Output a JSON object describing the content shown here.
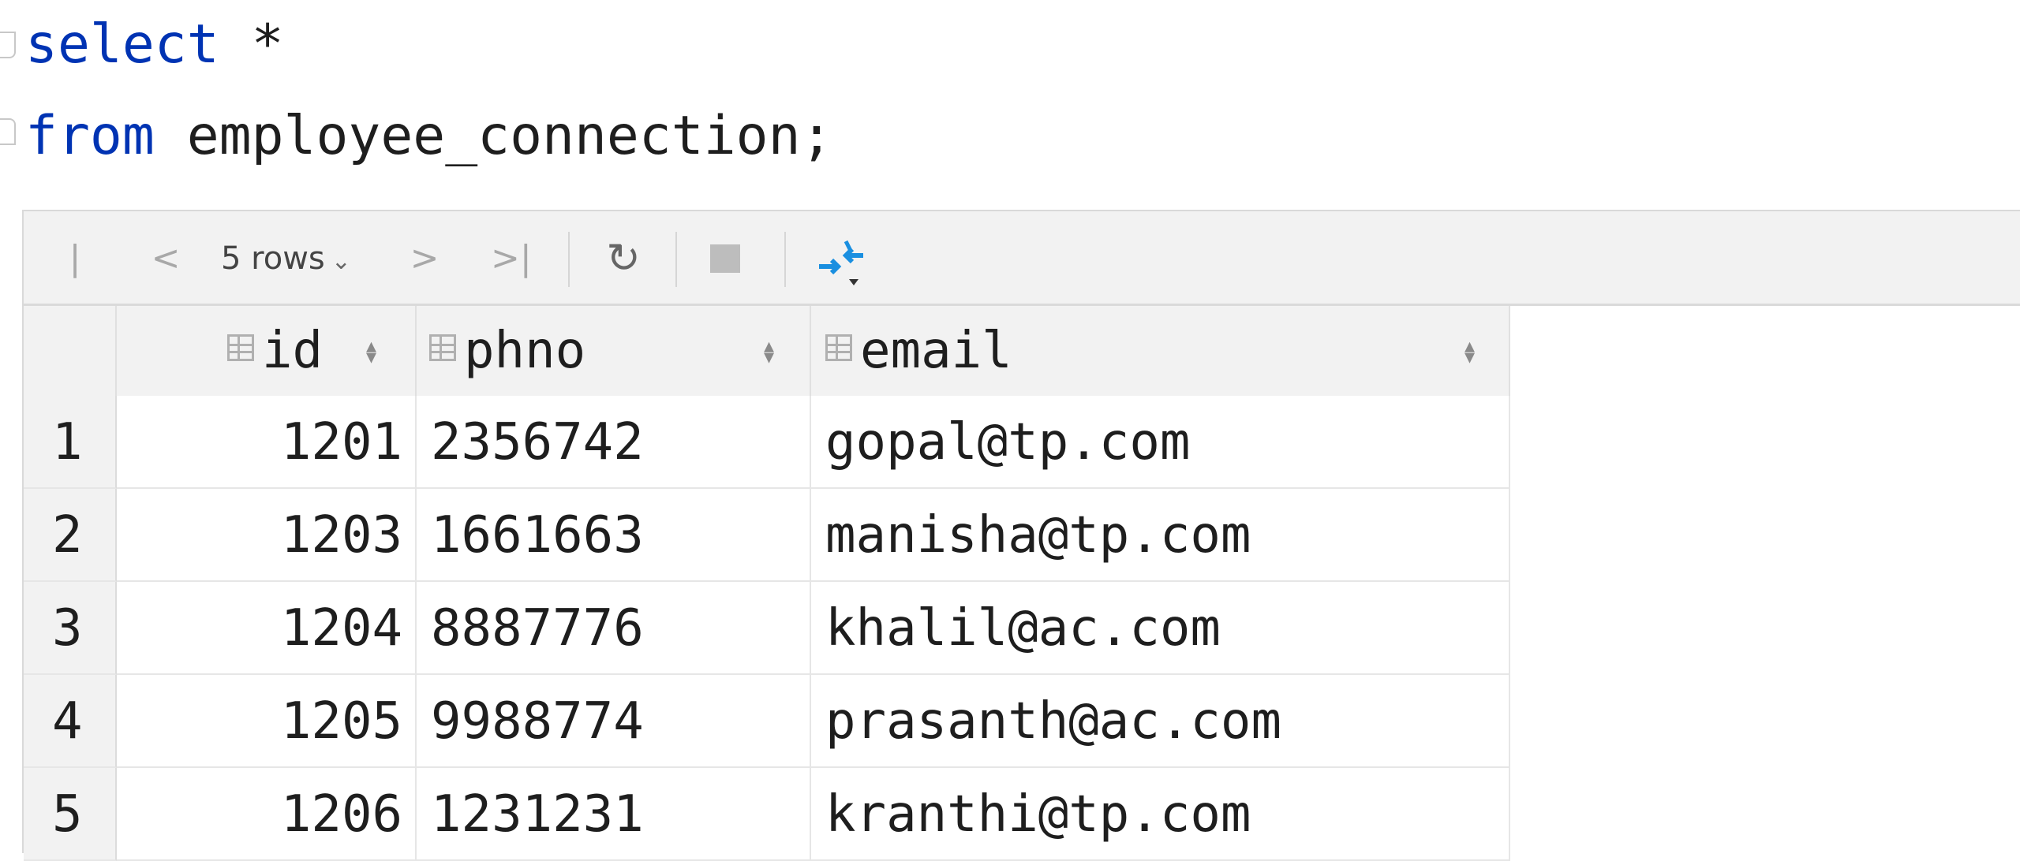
{
  "editor": {
    "line1": {
      "keyword": "select",
      "rest": " *"
    },
    "line2": {
      "keyword": "from",
      "rest": " employee_connection;"
    }
  },
  "toolbar": {
    "first_icon": "first-page-icon",
    "prev_icon": "prev-page-icon",
    "rows_label": "5 rows",
    "next_icon": "next-page-icon",
    "last_icon": "last-page-icon",
    "reload_icon": "reload-icon",
    "stop_icon": "stop-icon",
    "compare_icon": "compare-icon"
  },
  "grid": {
    "columns": [
      "id",
      "phno",
      "email"
    ],
    "rows": [
      {
        "num": "1",
        "id": "1201",
        "phno": "2356742",
        "email": "gopal@tp.com"
      },
      {
        "num": "2",
        "id": "1203",
        "phno": "1661663",
        "email": "manisha@tp.com"
      },
      {
        "num": "3",
        "id": "1204",
        "phno": "8887776",
        "email": "khalil@ac.com"
      },
      {
        "num": "4",
        "id": "1205",
        "phno": "9988774",
        "email": "prasanth@ac.com"
      },
      {
        "num": "5",
        "id": "1206",
        "phno": "1231231",
        "email": "kranthi@tp.com"
      }
    ]
  },
  "colors": {
    "keyword": "#0033b3",
    "compare_icon": "#1a8fe0"
  }
}
